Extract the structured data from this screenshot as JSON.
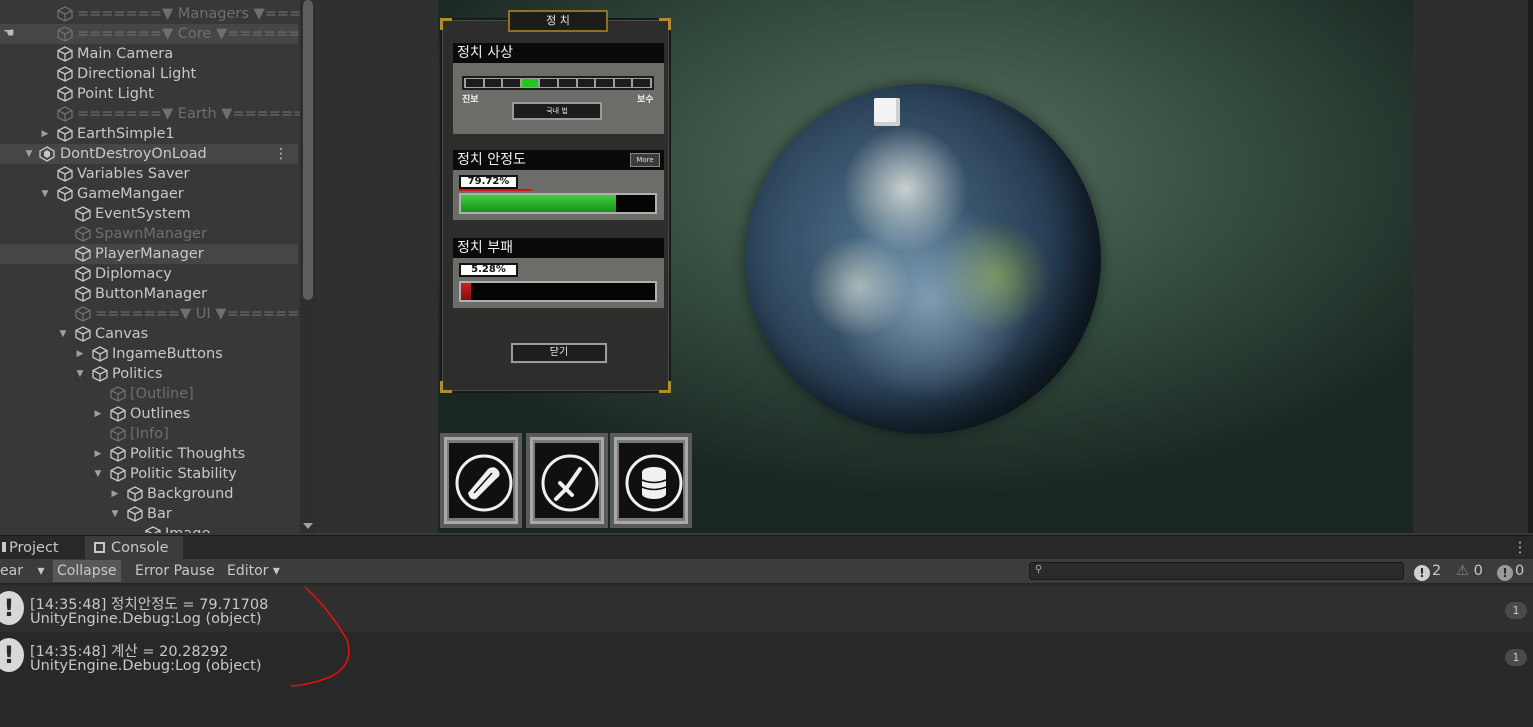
{
  "hierarchy": {
    "rows": [
      {
        "label": "=======▼ Managers ▼===",
        "dim": true
      },
      {
        "label": "=======▼ Core ▼=======",
        "dim": true
      },
      {
        "label": "Main Camera"
      },
      {
        "label": "Directional Light"
      },
      {
        "label": "Point Light"
      },
      {
        "label": "=======▼ Earth ▼=======",
        "dim": true
      },
      {
        "label": "EarthSimple1"
      },
      {
        "label": "DontDestroyOnLoad"
      },
      {
        "label": "Variables Saver"
      },
      {
        "label": "GameMangaer"
      },
      {
        "label": "EventSystem"
      },
      {
        "label": "SpawnManager",
        "dim": true
      },
      {
        "label": "PlayerManager"
      },
      {
        "label": "Diplomacy"
      },
      {
        "label": "ButtonManager"
      },
      {
        "label": "=======▼ UI ▼=======",
        "dim": true
      },
      {
        "label": "Canvas"
      },
      {
        "label": "IngameButtons"
      },
      {
        "label": "Politics"
      },
      {
        "label": "[Outline]",
        "dim": true
      },
      {
        "label": "Outlines"
      },
      {
        "label": "[Info]",
        "dim": true
      },
      {
        "label": "Politic Thoughts"
      },
      {
        "label": "Politic Stability"
      },
      {
        "label": "Background"
      },
      {
        "label": "Bar"
      },
      {
        "label": "Image"
      }
    ]
  },
  "game_ui": {
    "panel_title": "정 치",
    "thought": {
      "header": "정치 사상",
      "left_label": "진보",
      "right_label": "보수",
      "button": "국내 법",
      "slider_segments": 10,
      "slider_active_index": 3
    },
    "stability": {
      "header": "정치 안정도",
      "more": "More",
      "percent_text": "79.72%",
      "value": 0.7972
    },
    "corruption": {
      "header": "정치 부패",
      "percent_text": "5.28%",
      "value": 0.0528
    },
    "close_button": "닫기",
    "icons": [
      "scroll-icon",
      "sword-icon",
      "coins-icon"
    ]
  },
  "console": {
    "tabs": [
      "Project",
      "Console"
    ],
    "toolbar": {
      "clear": "ear",
      "collapse": "Collapse",
      "error_pause": "Error Pause",
      "editor": "Editor"
    },
    "counts": {
      "info": "2",
      "warnings": "0",
      "errors": "0"
    },
    "logs": [
      {
        "line1": "[14:35:48] 정치안정도 = 79.71708",
        "line2": "UnityEngine.Debug:Log (object)",
        "count": "1"
      },
      {
        "line1": "[14:35:48] 계산 = 20.28292",
        "line2": "UnityEngine.Debug:Log (object)",
        "count": "1"
      }
    ]
  },
  "colors": {
    "bar_green": "#1fbf1f",
    "bar_red": "#b01818",
    "accent_gold": "#b18c2c"
  }
}
